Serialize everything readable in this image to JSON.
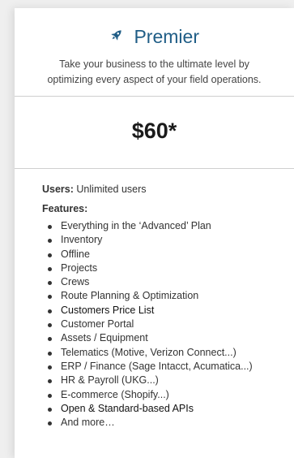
{
  "plan": {
    "icon": "rocket-icon",
    "title": "Premier",
    "tagline_line1": "Take your business to the ultimate level by",
    "tagline_line2": "optimizing every aspect of your field operations.",
    "price": "$60*"
  },
  "details": {
    "users_label": "Users:",
    "users_value": "Unlimited users",
    "features_label": "Features:",
    "features": [
      "Everything in the ‘Advanced’ Plan",
      "Inventory",
      "Offline",
      "Projects",
      "Crews",
      "Route Planning & Optimization",
      "Customers Price List",
      "Customer Portal",
      "Assets / Equipment",
      "Telematics (Motive, Verizon Connect...)",
      "ERP / Finance (Sage Intacct, Acumatica...)",
      "HR & Payroll (UKG...)",
      "E-commerce (Shopify...)",
      "Open & Standard-based APIs",
      "And more…"
    ]
  },
  "colors": {
    "title": "#1f5d86",
    "page_background": "#efefef",
    "card_background": "#ffffff"
  }
}
